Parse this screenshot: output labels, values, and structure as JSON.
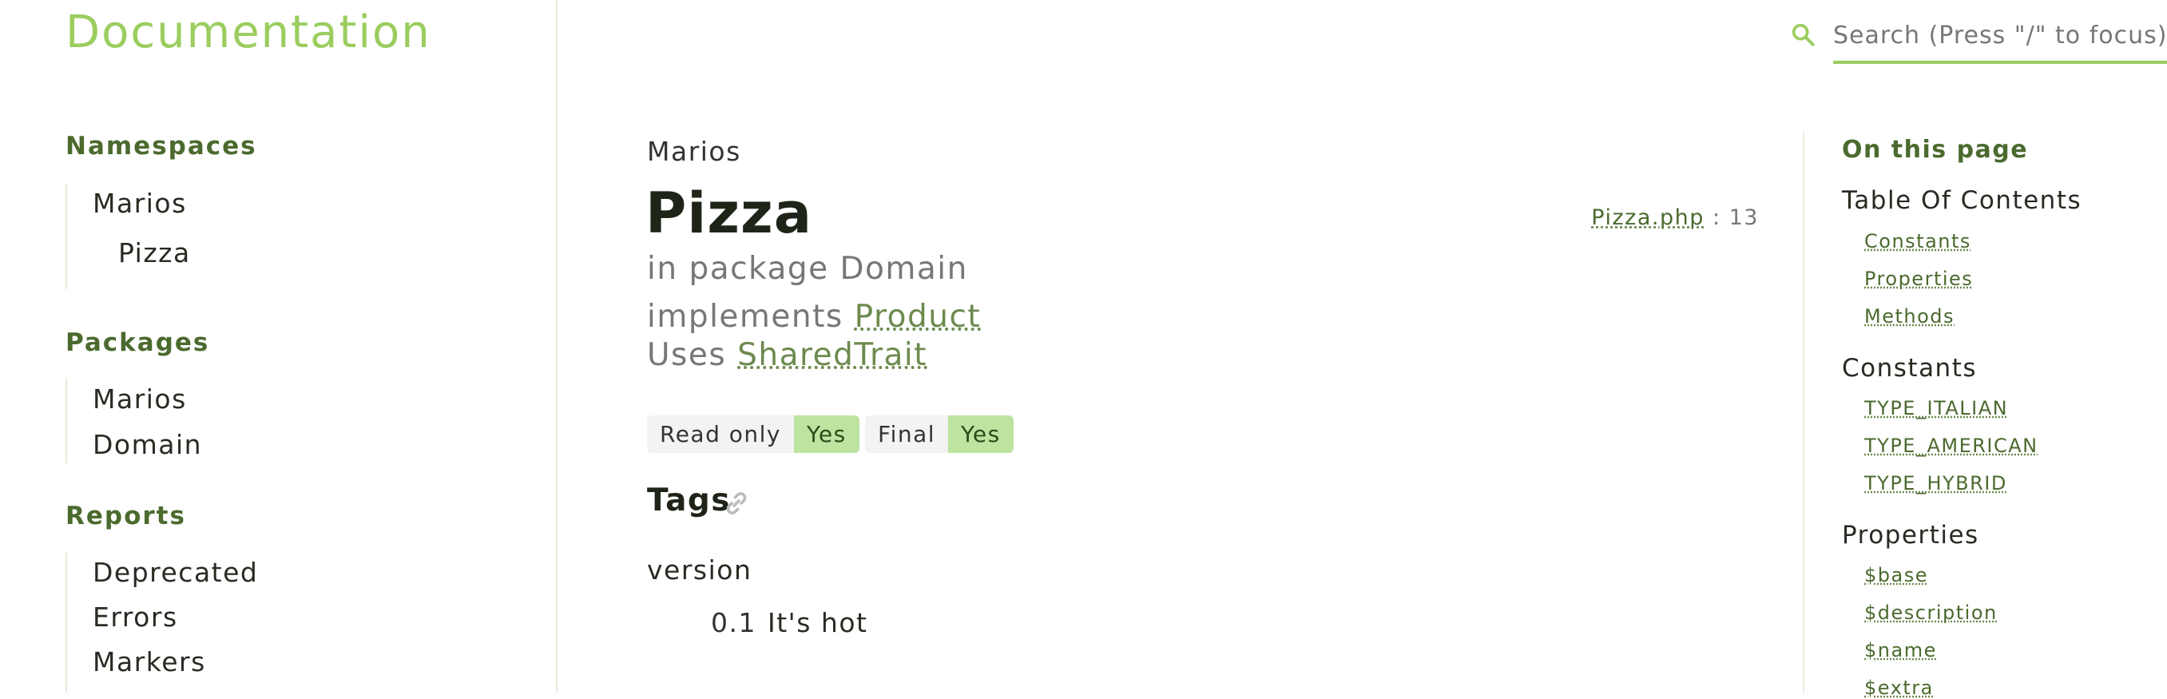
{
  "header": {
    "site_title": "Documentation",
    "search_placeholder": "Search (Press \"/\" to focus)"
  },
  "sidebar": {
    "namespaces_heading": "Namespaces",
    "namespaces": [
      "Marios",
      "Pizza"
    ],
    "packages_heading": "Packages",
    "packages": [
      "Marios",
      "Domain"
    ],
    "reports_heading": "Reports",
    "reports": [
      "Deprecated",
      "Errors",
      "Markers"
    ]
  },
  "main": {
    "breadcrumb": "Marios",
    "class_name": "Pizza",
    "source_file": "Pizza.php",
    "source_line": ": 13",
    "package_line": "in package Domain",
    "implements_prefix": "implements",
    "implements_link": "Product",
    "uses_prefix": "Uses",
    "uses_link": "SharedTrait",
    "badges": [
      {
        "key": "Read only",
        "value": "Yes"
      },
      {
        "key": "Final",
        "value": "Yes"
      }
    ],
    "tags_heading": "Tags",
    "tag_name": "version",
    "tag_version": "0.1",
    "tag_description": "It's hot"
  },
  "toc": {
    "heading": "On this page",
    "sections": [
      {
        "title": "Table Of Contents",
        "links": [
          "Constants",
          "Properties",
          "Methods"
        ]
      },
      {
        "title": "Constants",
        "links": [
          "TYPE_ITALIAN",
          "TYPE_AMERICAN",
          "TYPE_HYBRID"
        ]
      },
      {
        "title": "Properties",
        "links": [
          "$base",
          "$description",
          "$name",
          "$extra"
        ]
      }
    ]
  },
  "colors": {
    "brand": "#9bcd5f",
    "heading_green": "#4b6a2e",
    "badge_value_bg": "#bde3a0"
  },
  "icons": [
    "search-icon",
    "link-icon"
  ]
}
